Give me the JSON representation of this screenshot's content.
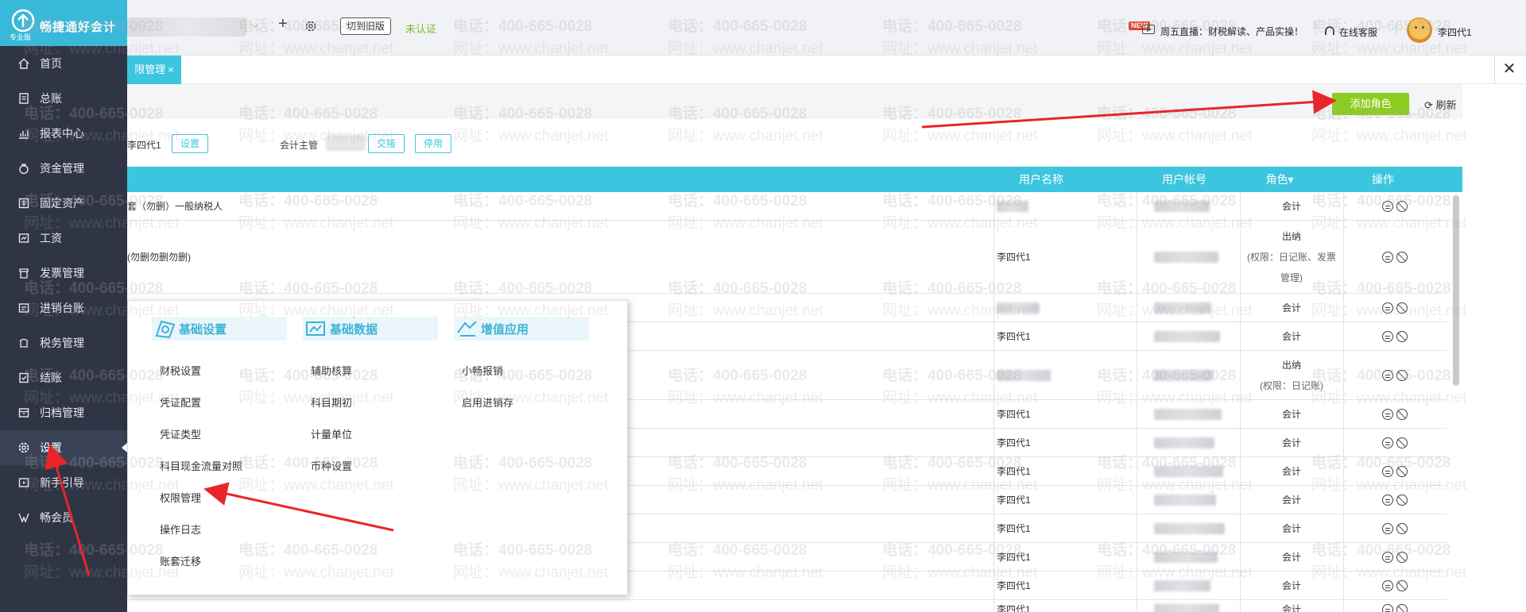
{
  "app": {
    "name": "畅捷通好会计",
    "edition": "专业版",
    "brand_color": "#38b9d9",
    "accent_color": "#3cc5de",
    "primary_button_color": "#8ccd1f"
  },
  "topbar": {
    "old_version_label": "切到旧版",
    "unverified_label": "未认证",
    "new_badge": "NEW",
    "live_label": "周五直播：财税解读、产品实操！",
    "service_label": "在线客服",
    "user_name": "李四代1"
  },
  "sidebar": {
    "items": [
      {
        "label": "首页",
        "icon": "home-icon"
      },
      {
        "label": "总账",
        "icon": "ledger-icon"
      },
      {
        "label": "报表中心",
        "icon": "chart-icon"
      },
      {
        "label": "资金管理",
        "icon": "money-bag-icon"
      },
      {
        "label": "固定资产",
        "icon": "asset-icon"
      },
      {
        "label": "工资",
        "icon": "salary-icon"
      },
      {
        "label": "发票管理",
        "icon": "invoice-icon"
      },
      {
        "label": "进销台账",
        "icon": "inventory-icon"
      },
      {
        "label": "税务管理",
        "icon": "tax-icon"
      },
      {
        "label": "结账",
        "icon": "checkout-icon"
      },
      {
        "label": "归档管理",
        "icon": "archive-icon"
      },
      {
        "label": "设置",
        "icon": "gear-icon",
        "active": true
      },
      {
        "label": "新手引导",
        "icon": "guide-icon"
      },
      {
        "label": "畅会员",
        "icon": "vip-icon"
      }
    ]
  },
  "tabs": {
    "active_tab": "限管理",
    "close_symbol": "×",
    "close_all_symbol": "✕"
  },
  "toolbar": {
    "add_role_label": "添加角色",
    "refresh_label": "刷新"
  },
  "supervisor": {
    "name": "李四代1",
    "set_label": "设置",
    "accountant_label": "会计主管",
    "handover_label": "交接",
    "disable_label": "停用"
  },
  "table": {
    "columns": [
      "用户名称",
      "用户帐号",
      "角色",
      "操作"
    ],
    "role_sort_symbol": "▾",
    "rows": [
      {
        "name": "套（勿删）一般纳税人",
        "user": "",
        "role": "会计"
      },
      {
        "name": "(勿删勿删勿删)",
        "user": "李四代1",
        "role": "出纳",
        "role_note": "(权限：日记账、发票管理)"
      },
      {
        "name": "",
        "user": "",
        "role": "会计"
      },
      {
        "name": "",
        "user": "李四代1",
        "role": "会计"
      },
      {
        "name": "",
        "user": "",
        "role": "出纳",
        "role_note": "(权限：日记账)"
      },
      {
        "name": "",
        "user": "李四代1",
        "role": "会计"
      },
      {
        "name": "",
        "user": "李四代1",
        "role": "会计"
      },
      {
        "name": "",
        "user": "李四代1",
        "role": "会计"
      },
      {
        "name": "",
        "user": "李四代1",
        "role": "会计"
      },
      {
        "name": "",
        "user": "李四代1",
        "role": "会计"
      },
      {
        "name": "",
        "user": "李四代1",
        "role": "会计"
      },
      {
        "name": "",
        "user": "李四代1",
        "role": "会计"
      },
      {
        "name": "",
        "user": "李四代1",
        "role": "会计"
      }
    ]
  },
  "settings_menu": {
    "columns": [
      {
        "title": "基础设置",
        "icon": "basic-settings-icon",
        "items": [
          "财税设置",
          "凭证配置",
          "凭证类型",
          "科目现金流量对照",
          "权限管理",
          "操作日志",
          "账套迁移"
        ]
      },
      {
        "title": "基础数据",
        "icon": "basic-data-icon",
        "items": [
          "辅助核算",
          "科目期初",
          "计量单位",
          "币种设置"
        ]
      },
      {
        "title": "增值应用",
        "icon": "value-added-icon",
        "items": [
          "小畅报销",
          "启用进销存"
        ]
      }
    ]
  },
  "watermark": {
    "phone": "电话：400-665-0028",
    "site": "网址：www.chanjet.net"
  }
}
